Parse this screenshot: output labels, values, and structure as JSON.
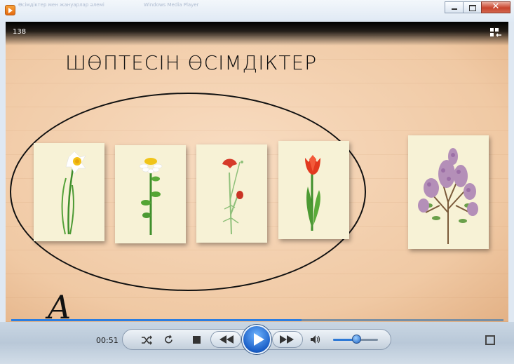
{
  "window": {
    "title": "Өсімдіктер мен жануарлар әлемі",
    "title_extra": "Windows Media Player",
    "minimize_icon": "minimize-icon",
    "maximize_icon": "maximize-icon",
    "close_label": "✕"
  },
  "video": {
    "frame_number": "138",
    "heading": "ШӨПТЕСІН ӨСІМДІКТЕР",
    "letter": "A",
    "progress": 0.59
  },
  "plants": [
    {
      "name": "daffodil",
      "icon": "daffodil-icon"
    },
    {
      "name": "chamomile",
      "icon": "chamomile-icon"
    },
    {
      "name": "carnation",
      "icon": "carnation-icon"
    },
    {
      "name": "tulip",
      "icon": "tulip-icon"
    },
    {
      "name": "lilac",
      "icon": "lilac-icon"
    }
  ],
  "controls": {
    "time": "00:51",
    "shuffle_icon": "shuffle-icon",
    "repeat_icon": "repeat-icon",
    "stop_icon": "stop-icon",
    "previous_icon": "previous-icon",
    "play_icon": "play-icon",
    "next_icon": "next-icon",
    "volume_icon": "speaker-icon",
    "volume_level": 0.45,
    "fullscreen_icon": "fullscreen-icon"
  },
  "colors": {
    "accent": "#1b5fc7",
    "background_wood": "#f0c9a4"
  }
}
